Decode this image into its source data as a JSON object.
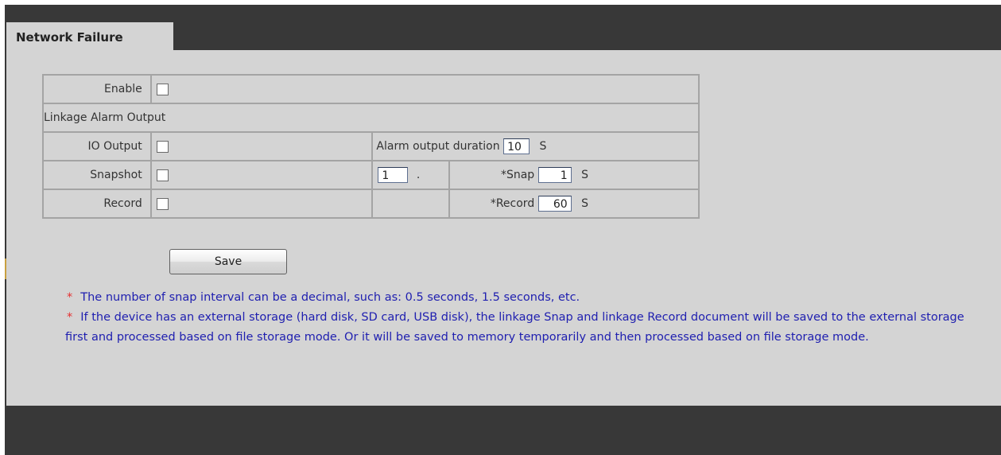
{
  "tab": {
    "title": "Network Failure"
  },
  "form": {
    "enable_label": "Enable",
    "linkage_header": "Linkage Alarm Output",
    "io_output_label": "IO Output",
    "alarm_duration_label": "Alarm output duration",
    "alarm_duration_value": "10",
    "alarm_duration_unit": "S",
    "snapshot_label": "Snapshot",
    "snapshot_count_value": "1",
    "snapshot_count_suffix": ".",
    "snap_interval_label": "*Snap",
    "snap_interval_value": "1",
    "snap_interval_unit": "S",
    "record_label": "Record",
    "record_duration_label": "*Record",
    "record_duration_value": "60",
    "record_duration_unit": "S",
    "checkboxes": {
      "enable": false,
      "io_output": false,
      "snapshot": false,
      "record": false
    }
  },
  "save_button": {
    "label": "Save"
  },
  "notes": {
    "marker": "*",
    "note1": "The number of snap interval can be a decimal, such as: 0.5 seconds, 1.5 seconds, etc.",
    "note2": "If the device has an external storage (hard disk, SD card, USB disk), the linkage Snap and linkage Record document will be saved to the external storage first and processed based on file storage mode. Or it will be saved to memory temporarily and then processed based on file storage mode."
  },
  "colors": {
    "background_dark": "#383838",
    "panel": "#d4d4d4",
    "border": "#a4a4a4",
    "note_text": "#2020b0",
    "note_marker": "#e53030"
  }
}
